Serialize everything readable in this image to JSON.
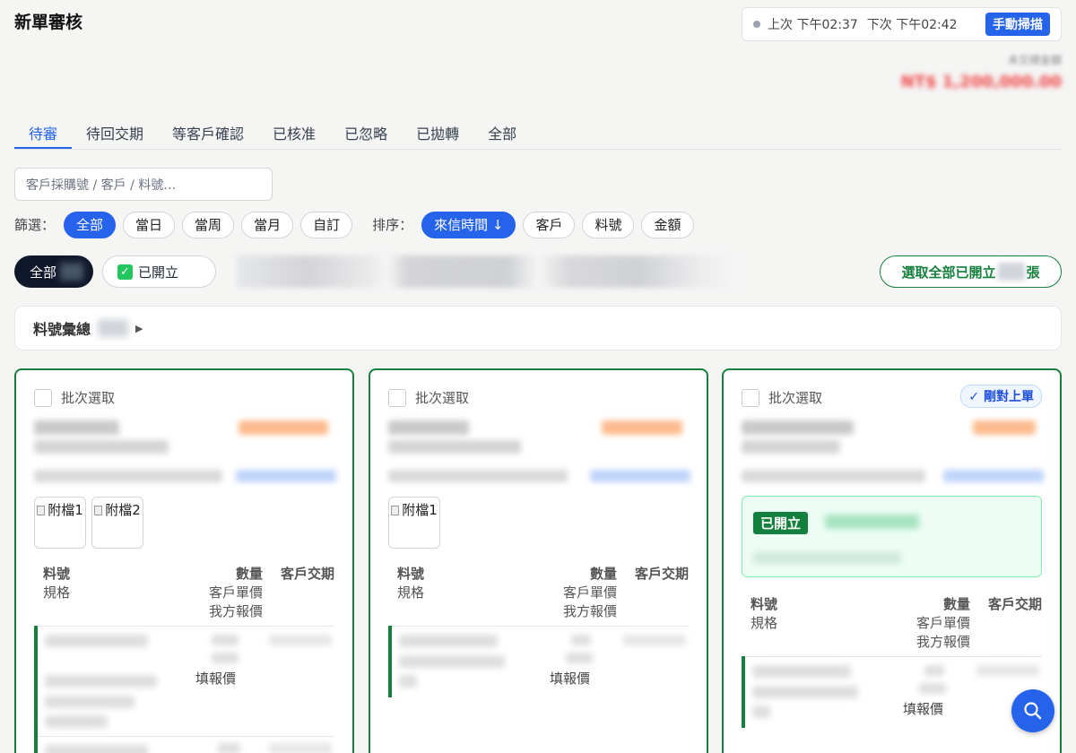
{
  "header": {
    "title": "新單審核",
    "last_scan": "上次 下午02:37",
    "next_scan": "下次 下午02:42",
    "scan_button": "手動掃描",
    "total_label": "未交總金額",
    "total_value": "NT$ 1,200,000.00"
  },
  "tabs": [
    "待審",
    "待回交期",
    "等客戶確認",
    "已核准",
    "已忽略",
    "已拋轉",
    "全部"
  ],
  "search": {
    "placeholder": "客戶採購號 / 客戶 / 料號…"
  },
  "filter": {
    "label": "篩選：",
    "options": [
      "全部",
      "當日",
      "當周",
      "當月",
      "自訂"
    ]
  },
  "sort": {
    "label": "排序：",
    "options": [
      "來信時間 ↓",
      "客戶",
      "料號",
      "金額"
    ]
  },
  "status": {
    "all_label": "全部",
    "opened_label": "已開立",
    "select_all_prefix": "選取全部已開立",
    "select_all_suffix": "張"
  },
  "summary": {
    "label": "料號彙總"
  },
  "card_labels": {
    "batch": "批次選取",
    "col_part": "料號",
    "col_spec": "規格",
    "col_qty": "數量",
    "col_cust_price": "客戶單價",
    "col_our_price": "我方報價",
    "col_date": "客戶交期",
    "fill_price": "填報價",
    "just_ordered": "✓ 剛對上單",
    "opened": "已開立"
  },
  "cards": [
    {
      "attachments": [
        "附檔1",
        "附檔2"
      ]
    },
    {
      "attachments": [
        "附檔1"
      ]
    },
    {
      "attachments": []
    }
  ],
  "colors": {
    "accent": "#2563eb",
    "green": "#15803d",
    "amount": "#ef4444"
  }
}
